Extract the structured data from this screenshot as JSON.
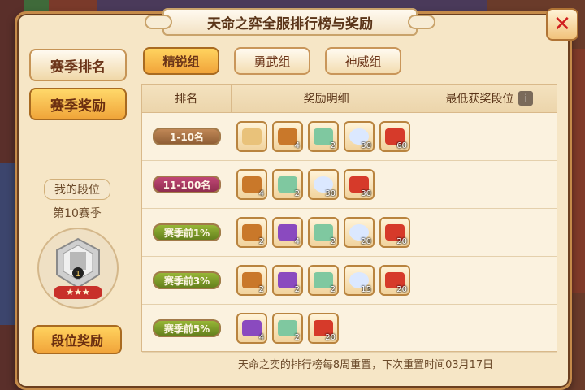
{
  "title": "天命之弈全服排行榜与奖励",
  "sidebar": {
    "season_rank_label": "赛季排名",
    "season_reward_label": "赛季奖励",
    "my_rank_label": "我的段位",
    "season_number": "第10赛季",
    "badge_stars": "★★★",
    "badge_level": "1",
    "rank_reward_button": "段位奖励"
  },
  "tabs": [
    "精锐组",
    "勇武组",
    "神威组"
  ],
  "table": {
    "headers": [
      "排名",
      "奖励明细",
      "最低获奖段位"
    ],
    "rows": [
      {
        "rank": "1-10名",
        "rewards": [
          {
            "icon": "scroll-icon",
            "count": ""
          },
          {
            "icon": "treasure-chest-icon",
            "count": "4"
          },
          {
            "icon": "potion-icon",
            "count": "2"
          },
          {
            "icon": "pearl-icon",
            "count": "30"
          },
          {
            "icon": "red-ticket-icon",
            "count": "60"
          }
        ]
      },
      {
        "rank": "11-100名",
        "rewards": [
          {
            "icon": "treasure-chest-icon",
            "count": "4"
          },
          {
            "icon": "potion-icon",
            "count": "2"
          },
          {
            "icon": "pearl-icon",
            "count": "30"
          },
          {
            "icon": "red-ticket-icon",
            "count": "30"
          }
        ]
      },
      {
        "rank": "赛季前1%",
        "rewards": [
          {
            "icon": "treasure-chest-icon",
            "count": "2"
          },
          {
            "icon": "purple-chest-icon",
            "count": "4"
          },
          {
            "icon": "potion-icon",
            "count": "2"
          },
          {
            "icon": "pearl-icon",
            "count": "20"
          },
          {
            "icon": "red-ticket-icon",
            "count": "20"
          }
        ]
      },
      {
        "rank": "赛季前3%",
        "rewards": [
          {
            "icon": "treasure-chest-icon",
            "count": "2"
          },
          {
            "icon": "purple-chest-icon",
            "count": "2"
          },
          {
            "icon": "potion-icon",
            "count": "2"
          },
          {
            "icon": "pearl-icon",
            "count": "15"
          },
          {
            "icon": "red-ticket-icon",
            "count": "20"
          }
        ]
      },
      {
        "rank": "赛季前5%",
        "rewards": [
          {
            "icon": "purple-chest-icon",
            "count": "4"
          },
          {
            "icon": "potion-icon",
            "count": "2"
          },
          {
            "icon": "red-ticket-icon",
            "count": "20"
          }
        ]
      }
    ]
  },
  "footer": "天命之奕的排行榜每8周重置，下次重置时间03月17日"
}
